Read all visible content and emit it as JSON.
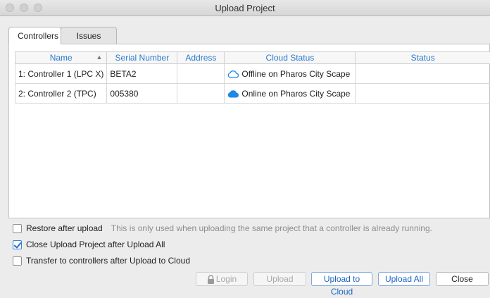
{
  "window": {
    "title": "Upload Project"
  },
  "tabs": [
    {
      "label": "Controllers"
    },
    {
      "label": "Issues"
    }
  ],
  "table": {
    "headers": [
      "Name",
      "Serial Number",
      "Address",
      "Cloud Status",
      "Status"
    ],
    "rows": [
      {
        "name": "1: Controller 1 (LPC X)",
        "serial": "BETA2",
        "address": "",
        "cloud_status": "Offline on Pharos City Scape",
        "cloud_icon": "cloud-outline-icon",
        "status": ""
      },
      {
        "name": "2: Controller 2 (TPC)",
        "serial": "005380",
        "address": "",
        "cloud_status": "Online on Pharos City Scape",
        "cloud_icon": "cloud-filled-icon",
        "status": ""
      }
    ]
  },
  "options": {
    "restore": {
      "label": "Restore after upload",
      "checked": false,
      "hint": "This is only used when uploading the same project that a controller is already running."
    },
    "close_after": {
      "label": "Close Upload Project after Upload All",
      "checked": true
    },
    "transfer": {
      "label": "Transfer to controllers after Upload to Cloud",
      "checked": false
    }
  },
  "buttons": {
    "login": "Login",
    "upload": "Upload",
    "upload_to_cloud": "Upload to Cloud",
    "upload_all": "Upload All",
    "close": "Close"
  },
  "colors": {
    "accent": "#2a7ad0",
    "cloud": "#1e88e5"
  }
}
